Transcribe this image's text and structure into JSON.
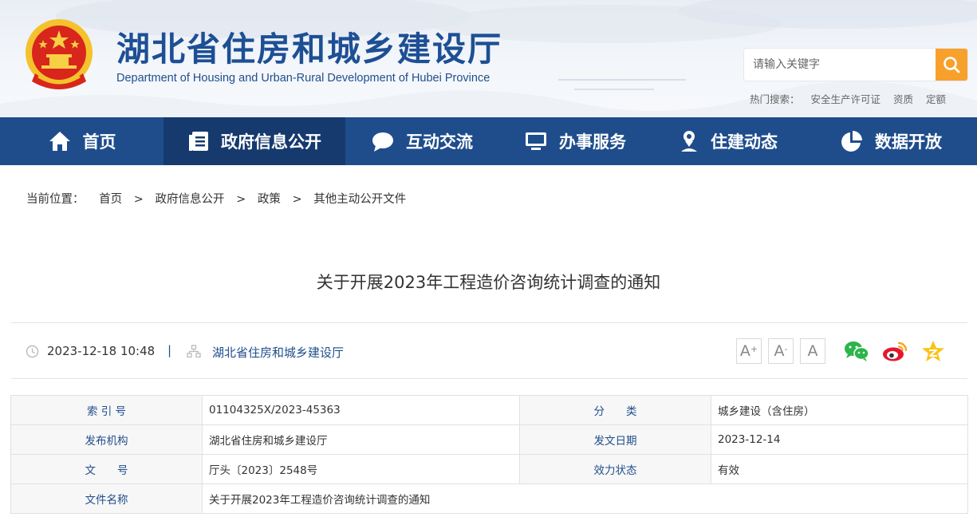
{
  "header": {
    "title": "湖北省住房和城乡建设厅",
    "subtitle": "Department of Housing and Urban-Rural Development of Hubei Province",
    "emblem_icon": "national-emblem-icon"
  },
  "search": {
    "placeholder": "请输入关键字",
    "button_icon": "search-icon"
  },
  "hot_search": {
    "label": "热门搜索：",
    "links": [
      "安全生产许可证",
      "资质",
      "定额"
    ]
  },
  "nav": {
    "items": [
      {
        "label": "首页",
        "icon": "home-icon"
      },
      {
        "label": "政府信息公开",
        "icon": "document-list-icon",
        "active": true
      },
      {
        "label": "互动交流",
        "icon": "chat-bubble-icon"
      },
      {
        "label": "办事服务",
        "icon": "monitor-icon"
      },
      {
        "label": "住建动态",
        "icon": "location-person-icon"
      },
      {
        "label": "数据开放",
        "icon": "pie-chart-icon"
      }
    ]
  },
  "breadcrumb": {
    "label": "当前位置：",
    "separator": ">",
    "items": [
      "首页",
      "政府信息公开",
      "政策",
      "其他主动公开文件"
    ]
  },
  "article": {
    "title": "关于开展2023年工程造价咨询统计调查的通知",
    "datetime": "2023-12-18 10:48",
    "divider": "|",
    "publisher": "湖北省住房和城乡建设厅"
  },
  "font_size": {
    "larger_label": "A",
    "larger_sup": "+",
    "smaller_label": "A",
    "smaller_sup": "-",
    "reset_label": "A"
  },
  "share": [
    "wechat-icon",
    "weibo-icon",
    "qzone-star-icon"
  ],
  "info": {
    "index_no_label": "索 引 号",
    "index_no": "01104325X/2023-45363",
    "category_label": "分　　类",
    "category": "城乡建设（含住房）",
    "issuer_label": "发布机构",
    "issuer": "湖北省住房和城乡建设厅",
    "issue_date_label": "发文日期",
    "issue_date": "2023-12-14",
    "doc_no_label": "文　　号",
    "doc_no": "厅头〔2023〕2548号",
    "status_label": "效力状态",
    "status": "有效",
    "doc_name_label": "文件名称",
    "doc_name": "关于开展2023年工程造价咨询统计调查的通知"
  },
  "colors": {
    "nav_bg": "#1f4d8c",
    "nav_active_bg": "#163a6e",
    "search_btn": "#f7a12c",
    "brand_blue": "#1d4f94"
  }
}
